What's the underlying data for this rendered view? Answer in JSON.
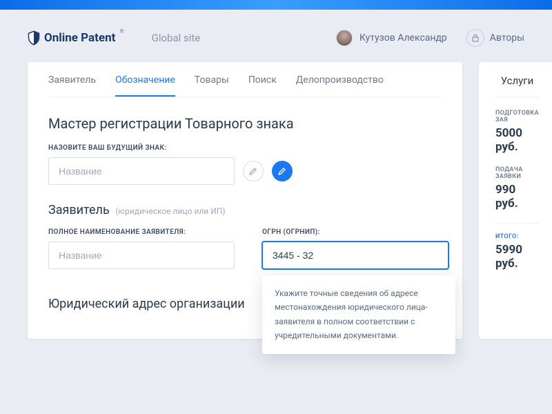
{
  "brand": {
    "name": "Online Patent",
    "reg": "®"
  },
  "nav": {
    "global": "Global site"
  },
  "user": {
    "name": "Кутузов Александр"
  },
  "authors": {
    "label": "Авторы"
  },
  "tabs": [
    "Заявитель",
    "Обозначение",
    "Товары",
    "Поиск",
    "Делопроизводство"
  ],
  "active_tab_index": 1,
  "wizard": {
    "title": "Мастер регистрации Товарного знака",
    "name_label": "НАЗОВИТЕ ВАШ БУДУЩИЙ ЗНАК:",
    "name_placeholder": "Название",
    "applicant_title": "Заявитель",
    "applicant_sub": "(юридическое лицо или ИП)",
    "full_name_label": "ПОЛНОЕ НАИМЕНОВАНИЕ ЗАЯВИТЕЛЯ:",
    "full_name_placeholder": "Название",
    "ogrn_label": "ОГРН (ОГРНИП):",
    "ogrn_value": "3445 - 32",
    "tooltip_text": "Укажите точные сведения об адресе местонахождения юридического лица-заявителя в полном соответствии с учредительными документами.",
    "address_title": "Юридический адрес организации"
  },
  "services": {
    "title": "Услуги",
    "items": [
      {
        "label": "ПОДГОТОВКА ЗАЯ",
        "value": "5000 руб."
      },
      {
        "label": "ПОДАЧА ЗАЯВКИ",
        "value": "990 руб."
      }
    ],
    "total_label": "ИТОГО:",
    "total_value": "5990 руб."
  }
}
